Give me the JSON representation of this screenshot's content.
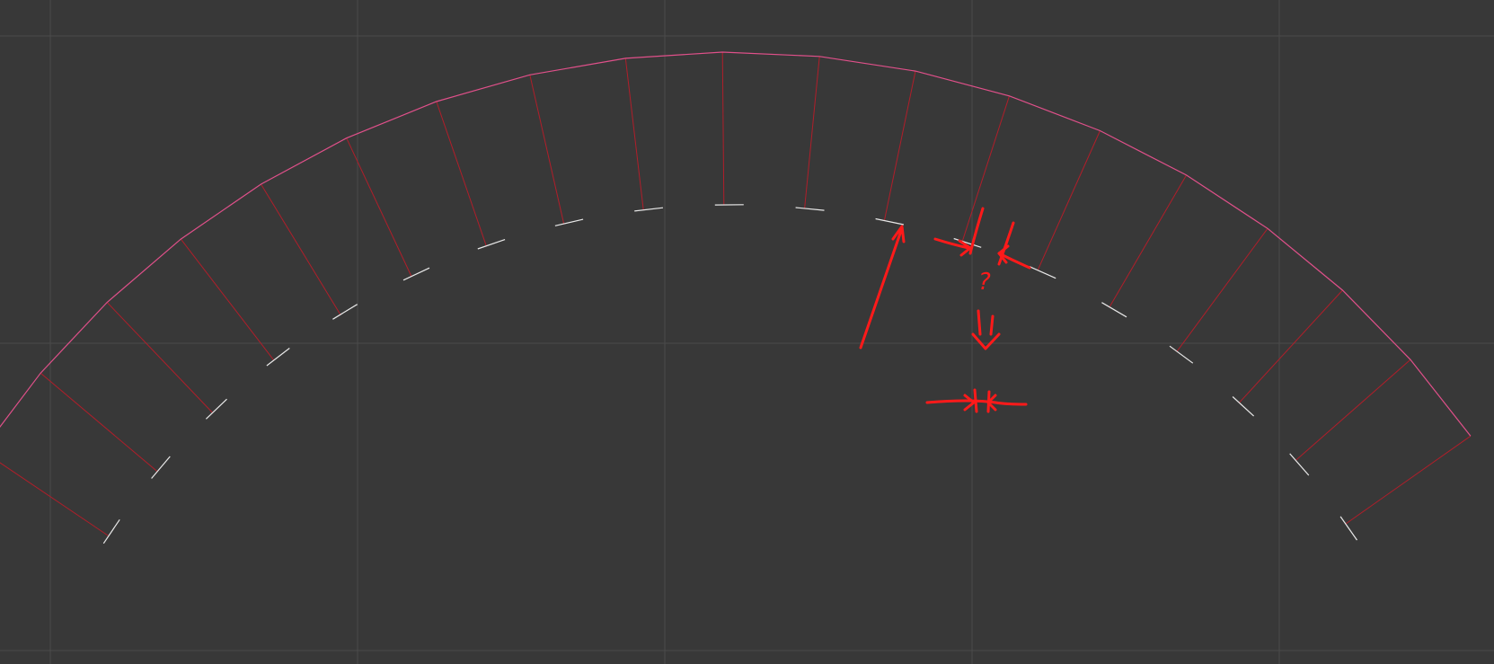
{
  "viewport": {
    "background": "#383838",
    "grid_color": "#4a4a4a",
    "curve_color": "#e0508a",
    "normal_color": "#b01e2a",
    "tick_color": "#e8e8e8",
    "annotation_color": "#ff1a1a"
  },
  "annotation": {
    "question_mark": "?"
  }
}
